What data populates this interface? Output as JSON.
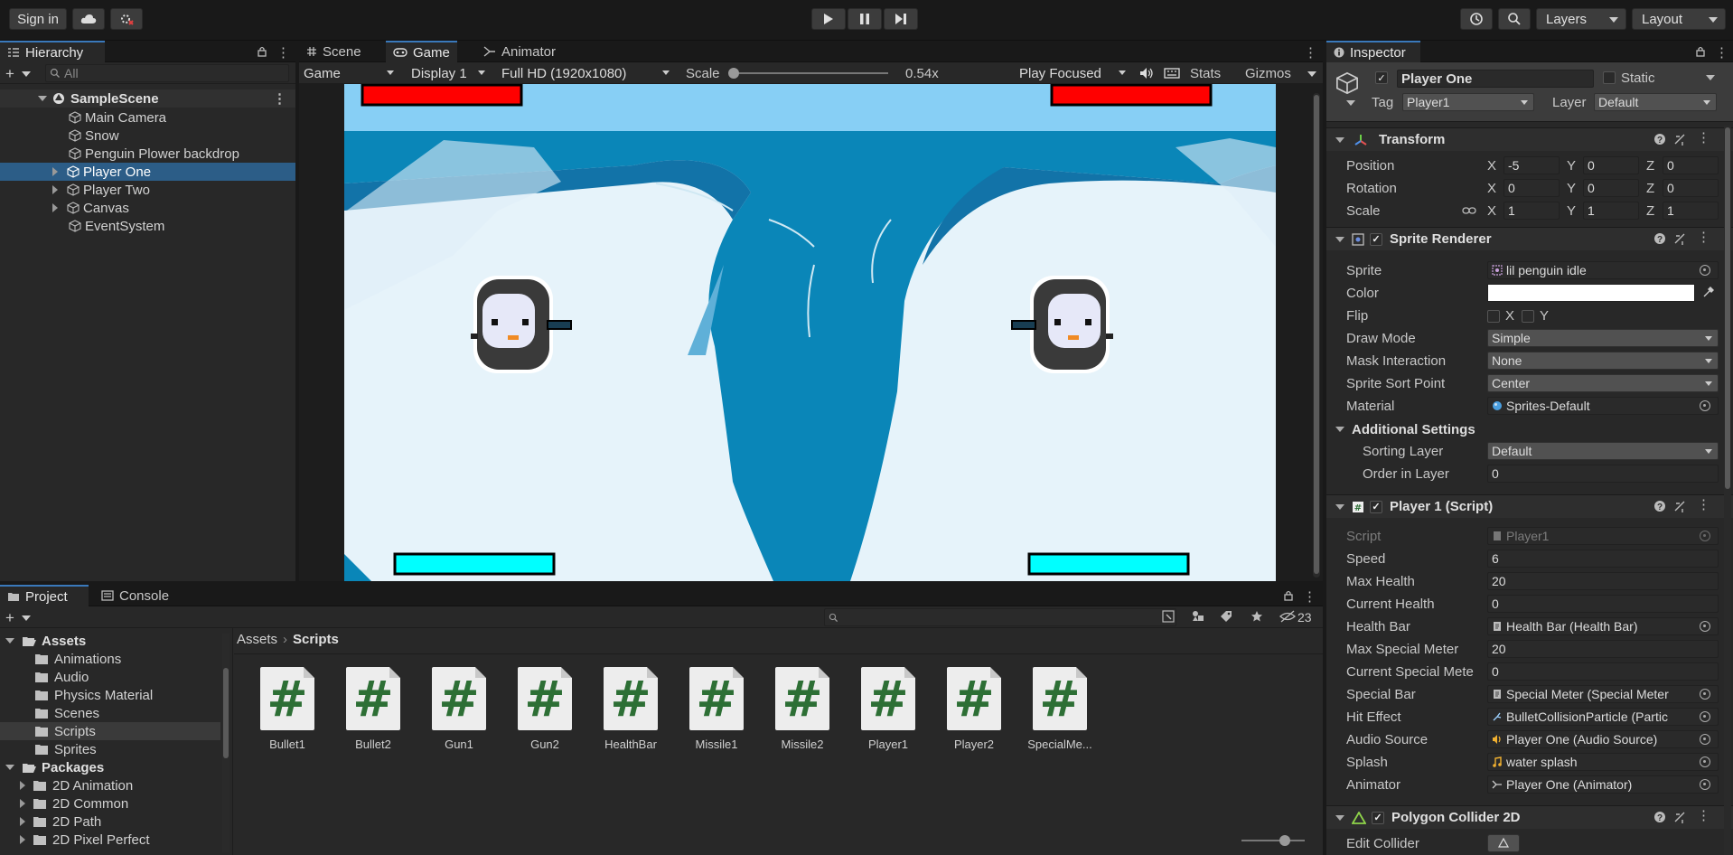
{
  "toolbar": {
    "sign_in": "Sign in",
    "layers": "Layers",
    "layout": "Layout"
  },
  "hierarchy": {
    "tab": "Hierarchy",
    "search_placeholder": "All",
    "scene": "SampleScene",
    "items": [
      {
        "label": "Main Camera"
      },
      {
        "label": "Snow"
      },
      {
        "label": "Penguin Plower backdrop"
      },
      {
        "label": "Player One"
      },
      {
        "label": "Player Two"
      },
      {
        "label": "Canvas"
      },
      {
        "label": "EventSystem"
      }
    ]
  },
  "center": {
    "tabs": [
      "Scene",
      "Game",
      "Animator"
    ],
    "game_dropdown": "Game",
    "display": "Display 1",
    "resolution": "Full HD (1920x1080)",
    "scale_label": "Scale",
    "scale_value": "0.54x",
    "scale_level": 0.02,
    "play_focused": "Play Focused",
    "stats": "Stats",
    "gizmos": "Gizmos"
  },
  "game": {
    "sky_color": "#87cff5",
    "ice_color": "#0a86b8",
    "health_color": "#ff0000",
    "special_color": "#00ffff"
  },
  "project": {
    "tabs": [
      "Project",
      "Console"
    ],
    "count": "23",
    "breadcrumb": [
      "Assets",
      "Scripts"
    ],
    "tree": [
      {
        "label": "Assets"
      },
      {
        "label": "Animations"
      },
      {
        "label": "Audio"
      },
      {
        "label": "Physics Material"
      },
      {
        "label": "Scenes"
      },
      {
        "label": "Scripts"
      },
      {
        "label": "Sprites"
      },
      {
        "label": "Packages"
      },
      {
        "label": "2D Animation"
      },
      {
        "label": "2D Common"
      },
      {
        "label": "2D Path"
      },
      {
        "label": "2D Pixel Perfect"
      }
    ],
    "assets": [
      "Bullet1",
      "Bullet2",
      "Gun1",
      "Gun2",
      "HealthBar",
      "Missile1",
      "Missile2",
      "Player1",
      "Player2",
      "SpecialMe..."
    ],
    "asset_icon": "#"
  },
  "inspector": {
    "tab": "Inspector",
    "object_name": "Player One",
    "static_label": "Static",
    "tag_label": "Tag",
    "tag_value": "Player1",
    "layer_label": "Layer",
    "layer_value": "Default",
    "transform": {
      "title": "Transform",
      "position_label": "Position",
      "rotation_label": "Rotation",
      "scale_label": "Scale",
      "axis": [
        "X",
        "Y",
        "Z"
      ],
      "position": [
        "-5",
        "0",
        "0"
      ],
      "rotation": [
        "0",
        "0",
        "0"
      ],
      "scale": [
        "1",
        "1",
        "1"
      ]
    },
    "sprite_renderer": {
      "title": "Sprite Renderer",
      "rows": [
        {
          "label": "Sprite",
          "value": "lil penguin idle"
        },
        {
          "label": "Color",
          "value": ""
        },
        {
          "label": "Flip",
          "value": ""
        },
        {
          "label": "Draw Mode",
          "value": "Simple"
        },
        {
          "label": "Mask Interaction",
          "value": "None"
        },
        {
          "label": "Sprite Sort Point",
          "value": "Center"
        },
        {
          "label": "Material",
          "value": "Sprites-Default"
        }
      ],
      "flip_x": "X",
      "flip_y": "Y",
      "additional": "Additional Settings",
      "sorting_layer_label": "Sorting Layer",
      "sorting_layer_value": "Default",
      "order_label": "Order in Layer",
      "order_value": "0"
    },
    "player_script": {
      "title": "Player 1 (Script)",
      "rows": [
        {
          "label": "Script",
          "value": "Player1"
        },
        {
          "label": "Speed",
          "value": "6"
        },
        {
          "label": "Max Health",
          "value": "20"
        },
        {
          "label": "Current Health",
          "value": "0"
        },
        {
          "label": "Health Bar",
          "value": "Health Bar (Health Bar)"
        },
        {
          "label": "Max Special Meter",
          "value": "20"
        },
        {
          "label": "Current Special Mete",
          "value": "0"
        },
        {
          "label": "Special Bar",
          "value": "Special Meter (Special Meter"
        },
        {
          "label": "Hit Effect",
          "value": "BulletCollisionParticle (Partic"
        },
        {
          "label": "Audio Source",
          "value": "Player One (Audio Source)"
        },
        {
          "label": "Splash",
          "value": "water splash"
        },
        {
          "label": "Animator",
          "value": "Player One (Animator)"
        }
      ]
    },
    "polygon_collider": {
      "title": "Polygon Collider 2D",
      "edit_label": "Edit Collider"
    }
  }
}
